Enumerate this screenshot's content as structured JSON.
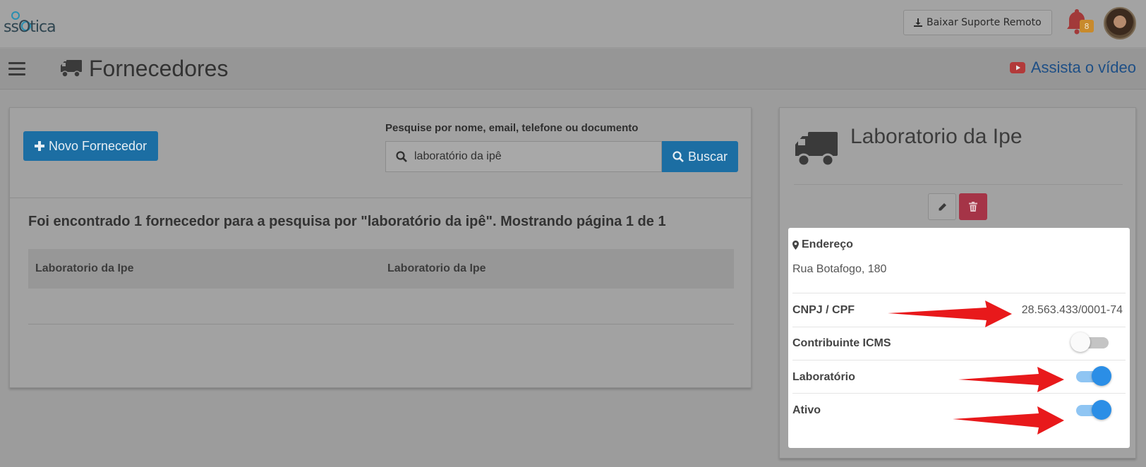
{
  "topbar": {
    "logo_text": "ssOtica",
    "remote_support_label": "Baixar Suporte Remoto",
    "notifications_count": "8"
  },
  "header": {
    "title": "Fornecedores",
    "video_link": "Assista o vídeo"
  },
  "toolbar": {
    "new_supplier_label": "Novo Fornecedor",
    "search_label": "Pesquise por nome, email, telefone ou documento",
    "search_value": "laboratório da ipê",
    "search_button_label": "Buscar"
  },
  "results": {
    "summary": "Foi encontrado 1 fornecedor para a pesquisa por \"laboratório da ipê\". Mostrando página 1 de 1",
    "rows": [
      {
        "name": "Laboratorio da Ipe",
        "trade_name": "Laboratorio da Ipe"
      }
    ]
  },
  "supplier_detail": {
    "name": "Laboratorio da Ipe",
    "address_label": "Endereço",
    "address_value": "Rua Botafogo, 180",
    "document_label": "CNPJ / CPF",
    "document_value": "28.563.433/0001-74",
    "icms_label": "Contribuinte ICMS",
    "icms_enabled": false,
    "lab_label": "Laboratório",
    "lab_enabled": true,
    "active_label": "Ativo",
    "active_enabled": true
  },
  "colors": {
    "primary": "#1c6ea3",
    "danger": "#a53447",
    "toggle_on": "#2b8ee6",
    "annotation_arrow": "#e8191b"
  }
}
